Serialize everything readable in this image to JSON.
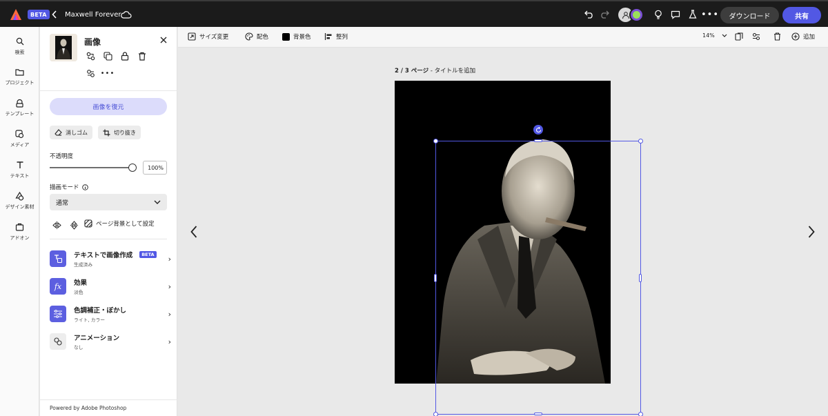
{
  "topbar": {
    "beta": "BETA",
    "doc_title": "Maxwell Forever",
    "download": "ダウンロード",
    "share": "共有",
    "icons": [
      "adobe-express-logo",
      "chevron-left-icon",
      "cloud-icon",
      "undo-icon",
      "redo-icon",
      "user-avatar-icon",
      "lightbulb-icon",
      "comment-icon",
      "flask-icon",
      "more-icon"
    ]
  },
  "rail": {
    "items": [
      {
        "label": "検索",
        "icon": "search-icon"
      },
      {
        "label": "プロジェクト",
        "icon": "folder-icon"
      },
      {
        "label": "テンプレート",
        "icon": "template-icon"
      },
      {
        "label": "メディア",
        "icon": "media-icon"
      },
      {
        "label": "テキスト",
        "icon": "text-icon"
      },
      {
        "label": "デザイン素材",
        "icon": "design-elements-icon"
      },
      {
        "label": "アドオン",
        "icon": "addons-icon"
      }
    ]
  },
  "panel": {
    "title": "画像",
    "restore": "画像を復元",
    "eraser": "消しゴム",
    "crop": "切り抜き",
    "opacity_label": "不透明度",
    "opacity_value": "100%",
    "opacity_fraction": 1.0,
    "blend_label": "描画モード",
    "blend_value": "通常",
    "set_bg": "ページ背景として設定",
    "features": [
      {
        "title": "テキストで画像作成",
        "sub": "生成済み",
        "badge": "BETA"
      },
      {
        "title": "効果",
        "sub": "淡色"
      },
      {
        "title": "色調補正・ぼかし",
        "sub": "ライト, カラー"
      },
      {
        "title": "アニメーション",
        "sub": "なし"
      }
    ],
    "powered": "Powered by Adobe Photoshop"
  },
  "canvas_toolbar": {
    "resize": "サイズ変更",
    "color": "配色",
    "background": "背景色",
    "align": "整列",
    "zoom": "14%",
    "add": "追加"
  },
  "canvas": {
    "page_counter": "2 / 3 ページ",
    "page_title_hint": " - タイトルを追加"
  },
  "colors": {
    "accent": "#5258e4",
    "topbar": "#1b1b1b"
  }
}
